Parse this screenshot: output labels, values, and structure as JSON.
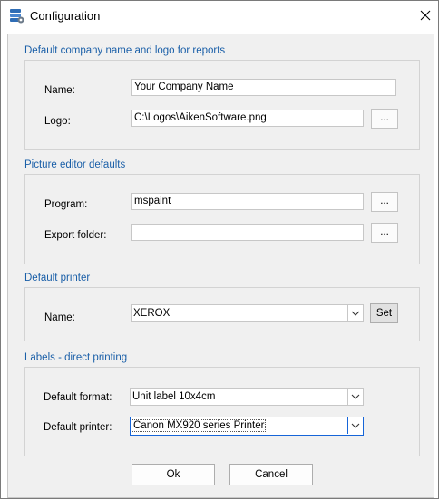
{
  "window": {
    "title": "Configuration",
    "app_icon": "database-settings-icon",
    "close_icon": "close-icon"
  },
  "company": {
    "section_title": "Default company name and logo for reports",
    "name_label": "Name:",
    "name_value": "Your Company Name",
    "logo_label": "Logo:",
    "logo_value": "C:\\Logos\\AikenSoftware.png",
    "browse_label": "..."
  },
  "picture_editor": {
    "section_title": "Picture editor defaults",
    "program_label": "Program:",
    "program_value": "mspaint",
    "export_label": "Export folder:",
    "export_value": "",
    "browse_label": "..."
  },
  "printer": {
    "section_title": "Default printer",
    "name_label": "Name:",
    "name_value": "XEROX",
    "set_label": "Set"
  },
  "labels": {
    "section_title": "Labels - direct printing",
    "format_label": "Default format:",
    "format_value": "Unit label  10x4cm",
    "printer_label": "Default printer:",
    "printer_value": "Canon MX920 series Printer"
  },
  "buttons": {
    "ok": "Ok",
    "cancel": "Cancel"
  }
}
